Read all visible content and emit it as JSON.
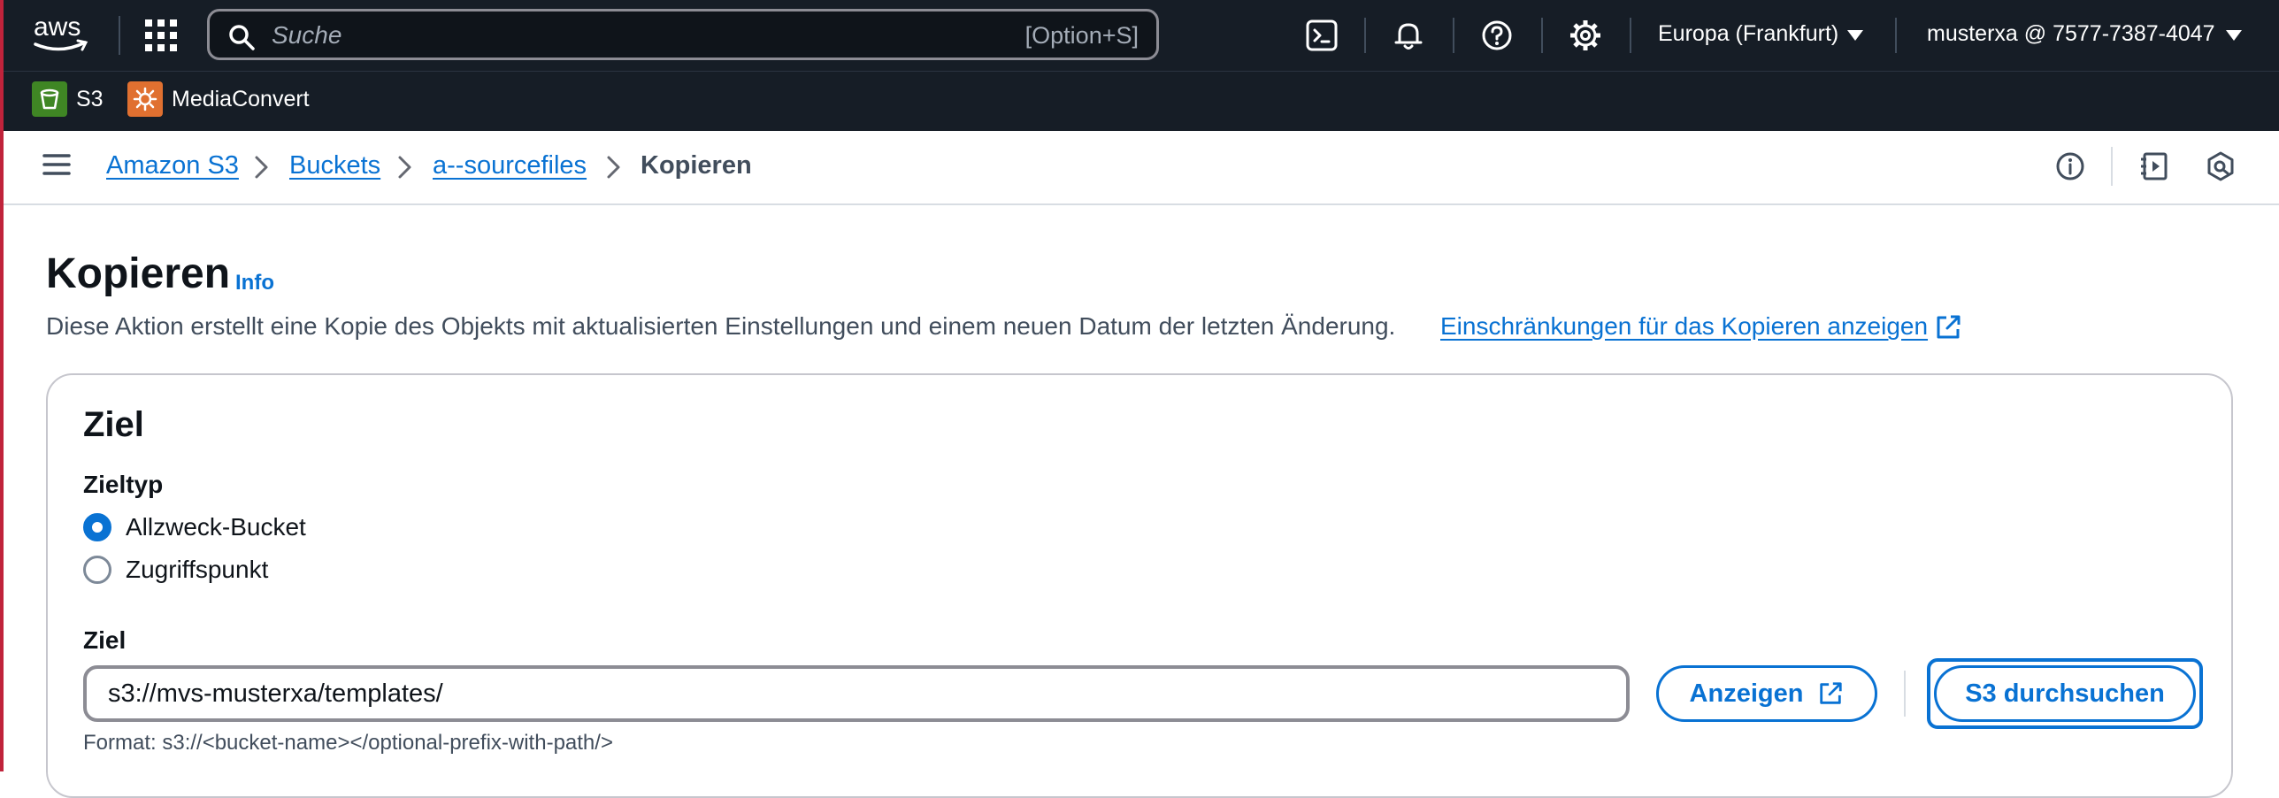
{
  "topnav": {
    "logo_text": "aws",
    "search_placeholder": "Suche",
    "search_shortcut": "[Option+S]",
    "region": "Europa (Frankfurt)",
    "account": "musterxa @ 7577-7387-4047"
  },
  "services": [
    {
      "label": "S3",
      "color": "#3f8624"
    },
    {
      "label": "MediaConvert",
      "color": "#e07030"
    }
  ],
  "breadcrumb": {
    "items": [
      "Amazon S3",
      "Buckets",
      "a--sourcefiles",
      "Kopieren"
    ]
  },
  "page": {
    "title": "Kopieren",
    "info_link": "Info",
    "description": "Diese Aktion erstellt eine Kopie des Objekts mit aktualisierten Einstellungen und einem neuen Datum der letzten Änderung.",
    "restrictions_link": "Einschränkungen für das Kopieren anzeigen"
  },
  "destination": {
    "panel_title": "Ziel",
    "type_label": "Zieltyp",
    "options": [
      {
        "label": "Allzweck-Bucket",
        "selected": true
      },
      {
        "label": "Zugriffspunkt",
        "selected": false
      }
    ],
    "field_label": "Ziel",
    "field_value": "s3://mvs-musterxa/templates/",
    "view_button": "Anzeigen",
    "browse_button": "S3 durchsuchen",
    "format_hint": "Format: s3://<bucket-name></optional-prefix-with-path/>"
  },
  "colors": {
    "nav_bg": "#161d26",
    "link_blue": "#0972d3",
    "text_dark": "#0f141a",
    "text_muted": "#414d5c"
  }
}
